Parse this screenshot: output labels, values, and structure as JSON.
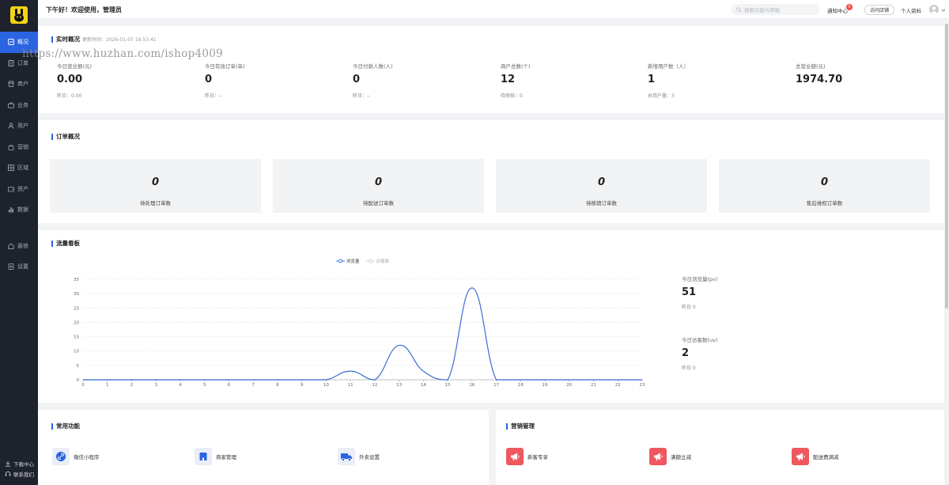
{
  "sidebar": {
    "items": [
      {
        "label": "概况",
        "icon": "dashboard-icon",
        "active": true
      },
      {
        "label": "订单",
        "icon": "order-icon"
      },
      {
        "label": "商户",
        "icon": "store-icon"
      },
      {
        "label": "业务",
        "icon": "briefcase-icon"
      },
      {
        "label": "用户",
        "icon": "user-icon"
      },
      {
        "label": "营销",
        "icon": "shopping-bag-icon"
      },
      {
        "label": "区域",
        "icon": "region-icon"
      },
      {
        "label": "资产",
        "icon": "wallet-icon"
      },
      {
        "label": "数据",
        "icon": "bar-chart-icon"
      },
      {
        "label": "装修",
        "icon": "home-icon"
      },
      {
        "label": "设置",
        "icon": "settings-icon"
      }
    ],
    "download_label": "下载中心",
    "contact_label": "联系我们"
  },
  "header": {
    "greeting": "下午好！欢迎使用，管理员",
    "search_placeholder": "搜索功能与帮助",
    "notice_label": "通知中心",
    "notice_count": "0",
    "visit_store_label": "访问店铺",
    "profile_label": "个人资料"
  },
  "watermark": "https://www.huzhan.com/ishop4009",
  "realtime": {
    "title": "实时概况",
    "updated": "更新时间：2026-01-07 16:53:41",
    "stats": [
      {
        "label": "今日营业额(元)",
        "value": "0.00",
        "sub": "昨日：0.00"
      },
      {
        "label": "今日有效订单(单)",
        "value": "0",
        "sub": "昨日：--"
      },
      {
        "label": "今日付款人数(人)",
        "value": "0",
        "sub": "昨日：--"
      },
      {
        "label": "商户总数(个)",
        "value": "12",
        "sub": "待审核：0"
      },
      {
        "label": "新增用户数（人）",
        "value": "1",
        "sub": "总用户量：3"
      },
      {
        "label": "总营业额(元)",
        "value": "1974.70",
        "sub": ""
      }
    ]
  },
  "orders": {
    "title": "订单概况",
    "cards": [
      {
        "value": "0",
        "label": "待处理订单数"
      },
      {
        "value": "0",
        "label": "待配送订单数"
      },
      {
        "value": "0",
        "label": "待核销订单数"
      },
      {
        "value": "0",
        "label": "售后维权订单数"
      }
    ]
  },
  "traffic": {
    "title": "流量看板",
    "pv_label": "今日浏览量(pv)",
    "pv_value": "51",
    "pv_sub": "昨日 0",
    "uv_label": "今日访客数(uv)",
    "uv_value": "2",
    "uv_sub": "昨日 0"
  },
  "chart_data": {
    "type": "line",
    "x": [
      0,
      1,
      2,
      3,
      4,
      5,
      6,
      7,
      8,
      9,
      10,
      11,
      12,
      13,
      14,
      15,
      16,
      17,
      18,
      19,
      20,
      21,
      22,
      23
    ],
    "series": [
      {
        "name": "浏览量",
        "values": [
          0,
          0,
          0,
          0,
          0,
          0,
          0,
          0,
          0,
          0,
          0,
          3,
          0,
          12,
          3,
          0,
          32,
          0,
          0,
          0,
          0,
          0,
          0,
          0
        ],
        "color": "#3a6ed8"
      },
      {
        "name": "访客数",
        "values": [
          0,
          0,
          0,
          0,
          0,
          0,
          0,
          0,
          0,
          0,
          0,
          0,
          0,
          0,
          0,
          0,
          0,
          0,
          0,
          0,
          0,
          0,
          0,
          0
        ],
        "color": "#cccccc"
      }
    ],
    "ylim": [
      0,
      35
    ],
    "yticks": [
      0,
      5,
      10,
      15,
      20,
      25,
      30,
      35
    ],
    "legend": "top-center",
    "grid": true
  },
  "common": {
    "title": "常用功能",
    "items": [
      {
        "label": "微信小程序",
        "icon": "link-icon"
      },
      {
        "label": "商家管理",
        "icon": "shop-icon"
      },
      {
        "label": "外卖设置",
        "icon": "delivery-truck-icon"
      }
    ]
  },
  "marketing": {
    "title": "营销管理",
    "items": [
      {
        "label": "新客专享",
        "icon": "megaphone-icon"
      },
      {
        "label": "满额立减",
        "icon": "megaphone-icon"
      },
      {
        "label": "配送费满减",
        "icon": "megaphone-icon"
      }
    ]
  },
  "colors": {
    "accent": "#2b64e0",
    "sidebar_bg": "#1d222c",
    "badge": "#f24848",
    "marketing_icon": "#f0575e"
  }
}
